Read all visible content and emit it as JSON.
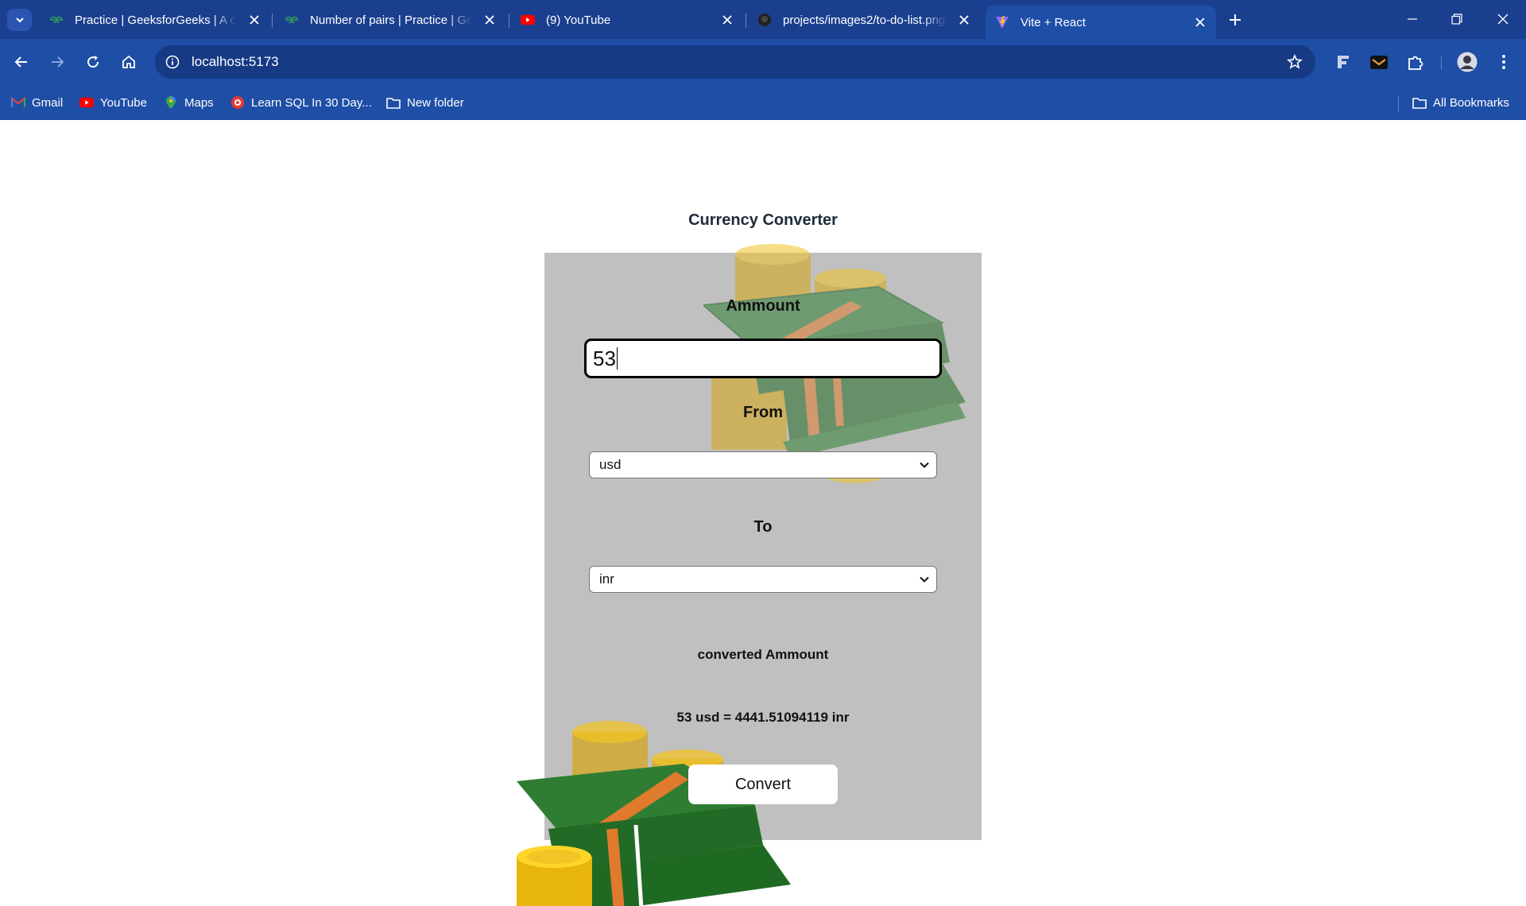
{
  "browser": {
    "tabs": [
      {
        "title": "Practice | GeeksforGeeks | A computer science portal for geeks",
        "favicon": "geeksforgeeks-icon",
        "active": false
      },
      {
        "title": "Number of pairs | Practice | GeeksforGeeks",
        "favicon": "geeksforgeeks-icon",
        "active": false
      },
      {
        "title": "(9) YouTube",
        "favicon": "youtube-icon",
        "active": false
      },
      {
        "title": "projects/images2/to-do-list.png",
        "favicon": "github-icon",
        "active": false
      },
      {
        "title": "Vite + React",
        "favicon": "vite-icon",
        "active": true
      }
    ],
    "address": "localhost:5173",
    "bookmarks": [
      {
        "label": "Gmail",
        "icon": "gmail-icon"
      },
      {
        "label": "YouTube",
        "icon": "youtube-icon"
      },
      {
        "label": "Maps",
        "icon": "maps-icon"
      },
      {
        "label": "Learn SQL In 30 Day...",
        "icon": "sql-icon"
      },
      {
        "label": "New folder",
        "icon": "folder-icon"
      }
    ],
    "all_bookmarks_label": "All Bookmarks",
    "colors": {
      "chrome": "#1e4ea6",
      "tabstrip": "#1b3f8f"
    }
  },
  "app": {
    "title": "Currency Converter",
    "amount_label": "Ammount",
    "amount_value": "53",
    "from_label": "From",
    "from_value": "usd",
    "to_label": "To",
    "to_value": "inr",
    "result_label": "converted Ammount",
    "result_text": "53 usd = 4441.51094119 inr",
    "convert_label": "Convert",
    "colors": {
      "card": "#c0c0c0",
      "button": "#ffffff"
    }
  }
}
